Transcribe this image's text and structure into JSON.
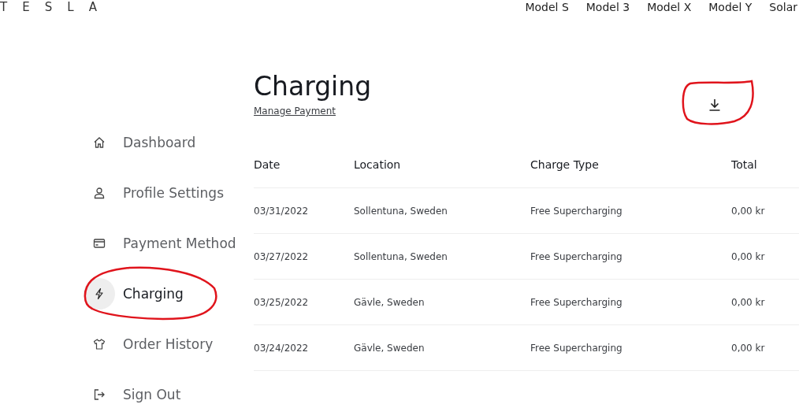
{
  "header": {
    "logo": "TESLA",
    "nav": [
      "Model S",
      "Model 3",
      "Model X",
      "Model Y",
      "Solar"
    ]
  },
  "sidebar": {
    "items": [
      {
        "label": "Dashboard",
        "kind": "home",
        "selected": false
      },
      {
        "label": "Profile Settings",
        "kind": "profile",
        "selected": false
      },
      {
        "label": "Payment Method",
        "kind": "card",
        "selected": false
      },
      {
        "label": "Charging",
        "kind": "bolt",
        "selected": true
      },
      {
        "label": "Order History",
        "kind": "shirt",
        "selected": false
      },
      {
        "label": "Sign Out",
        "kind": "signout",
        "selected": false
      }
    ]
  },
  "page": {
    "title": "Charging",
    "link": "Manage Payment"
  },
  "table": {
    "columns": [
      "Date",
      "Location",
      "Charge Type",
      "Total"
    ],
    "rows": [
      [
        "03/31/2022",
        "Sollentuna, Sweden",
        "Free Supercharging",
        "0,00 kr"
      ],
      [
        "03/27/2022",
        "Sollentuna, Sweden",
        "Free Supercharging",
        "0,00 kr"
      ],
      [
        "03/25/2022",
        "Gävle, Sweden",
        "Free Supercharging",
        "0,00 kr"
      ],
      [
        "03/24/2022",
        "Gävle, Sweden",
        "Free Supercharging",
        "0,00 kr"
      ]
    ]
  }
}
